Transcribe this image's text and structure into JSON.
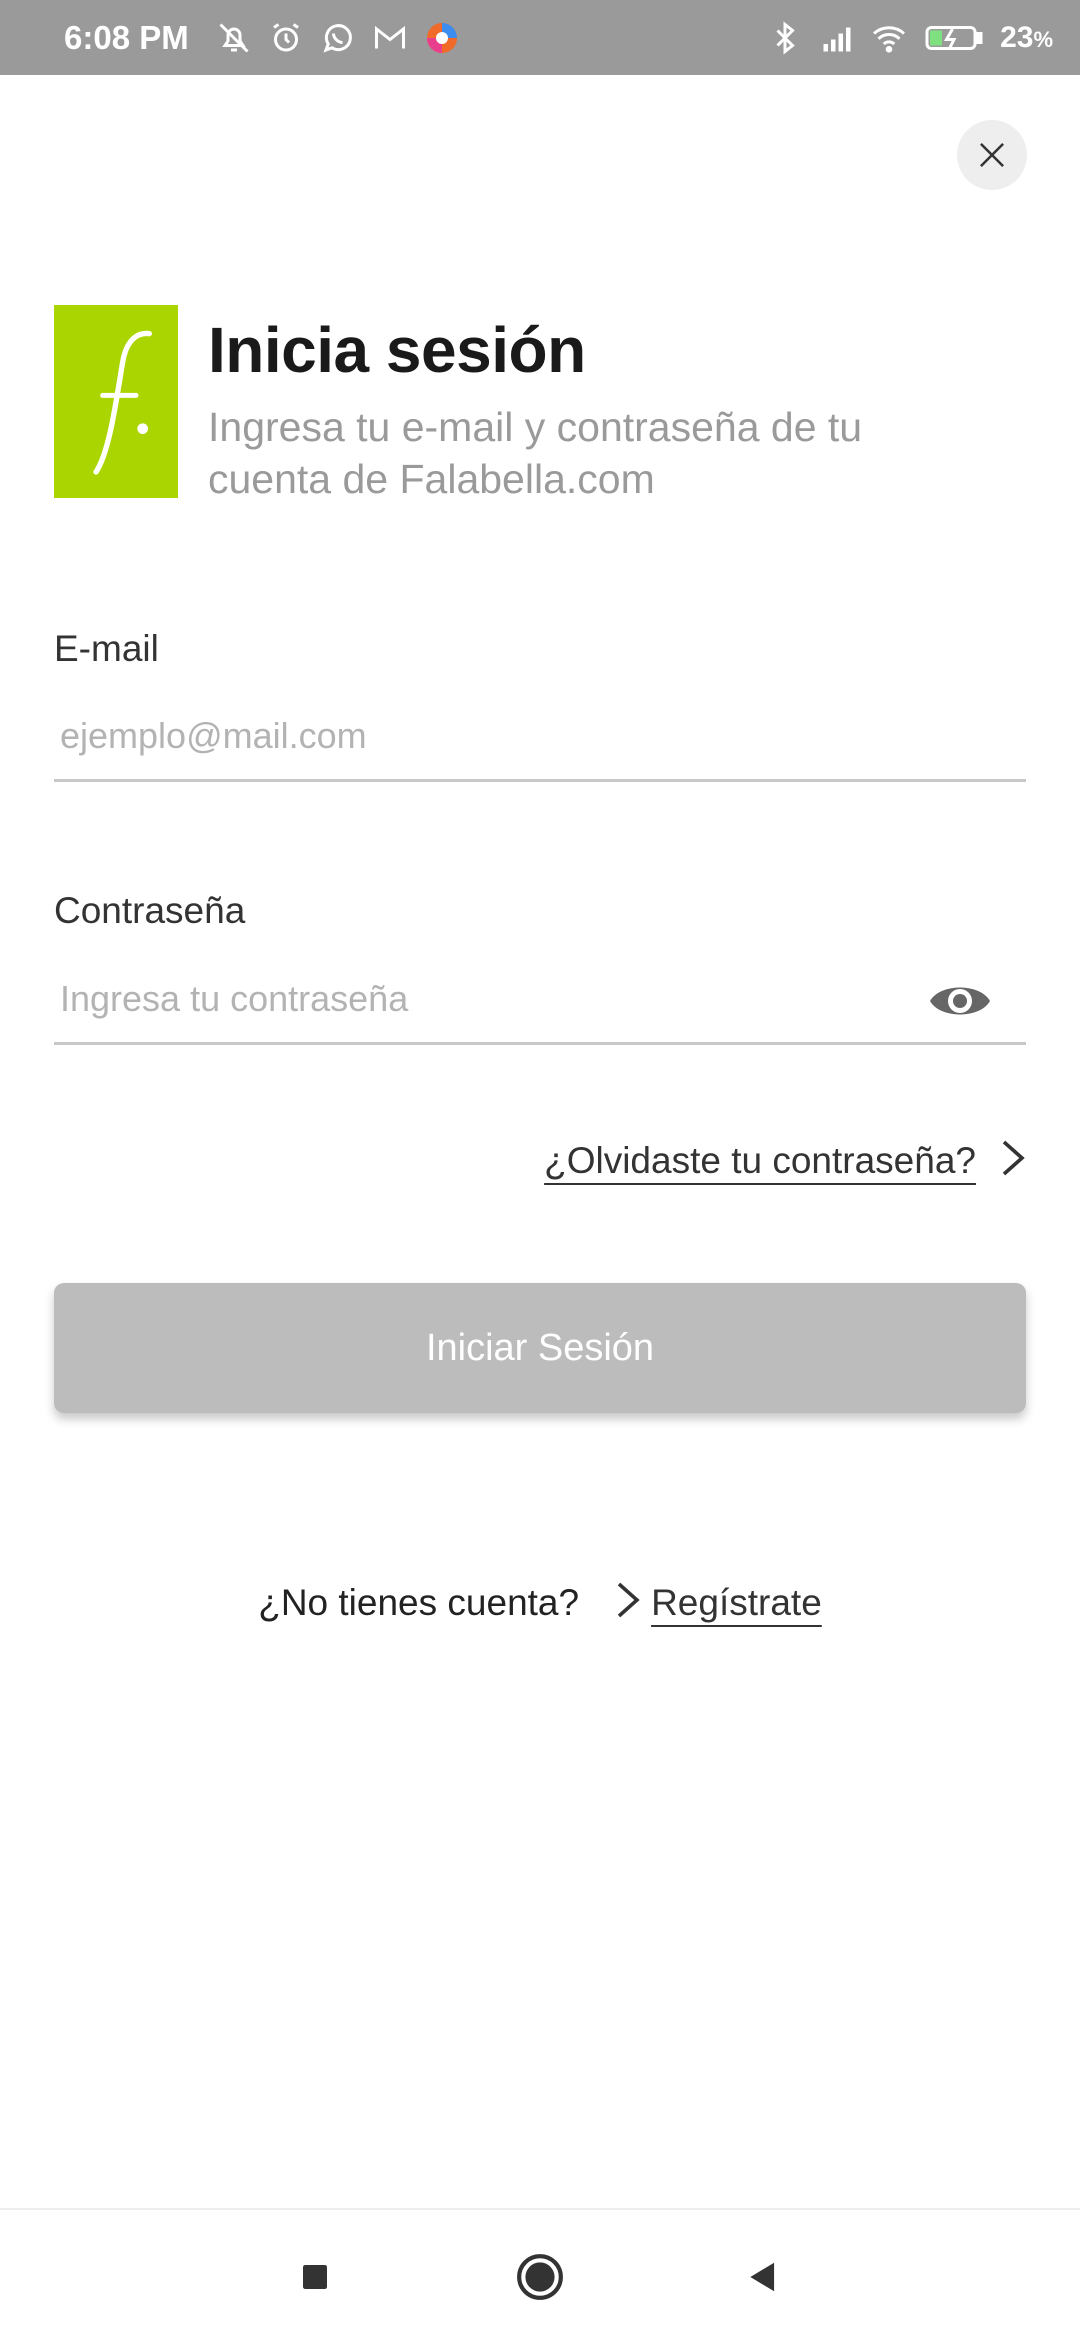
{
  "status_bar": {
    "time": "6:08 PM",
    "battery": "23",
    "battery_unit": "%",
    "left_icons": [
      "notifications-off-icon",
      "alarm-icon",
      "whatsapp-icon",
      "gmail-icon",
      "browser-icon"
    ],
    "right_icons": [
      "bluetooth-icon",
      "signal-icon",
      "wifi-icon",
      "battery-charging-icon"
    ]
  },
  "header": {
    "title": "Inicia sesión",
    "subtitle": "Ingresa tu e-mail y contraseña de tu cuenta de Falabella.com",
    "logo_icon": "falabella-logo",
    "logo_color": "#aad500"
  },
  "form": {
    "email_label": "E-mail",
    "email_placeholder": "ejemplo@mail.com",
    "email_value": "",
    "password_label": "Contraseña",
    "password_placeholder": "Ingresa tu contraseña",
    "password_value": "",
    "forgot_password": "¿Olvidaste tu contraseña?",
    "submit_label": "Iniciar Sesión",
    "submit_color": "#bcbcbc"
  },
  "register": {
    "prompt": "¿No tienes cuenta?",
    "link": "Regístrate"
  },
  "nav": {
    "icons": [
      "recents-square-icon",
      "home-circle-icon",
      "back-triangle-icon"
    ]
  }
}
